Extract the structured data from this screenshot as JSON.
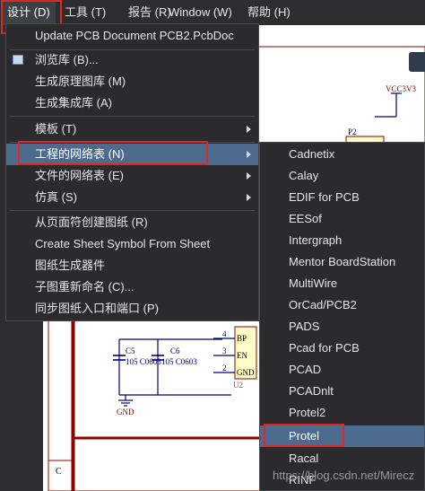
{
  "menubar": {
    "items": [
      {
        "label": "设计 (D)"
      },
      {
        "label": "工具 (T)"
      },
      {
        "label": "报告 (R)"
      },
      {
        "label": "Window (W)"
      },
      {
        "label": "帮助 (H)"
      }
    ]
  },
  "design_menu": {
    "items": [
      {
        "label": "Update PCB Document PCB2.PcbDoc"
      },
      {
        "label": "浏览库 (B)..."
      },
      {
        "label": "生成原理图库 (M)"
      },
      {
        "label": "生成集成库 (A)"
      },
      {
        "label": "模板 (T)"
      },
      {
        "label": "工程的网络表 (N)"
      },
      {
        "label": "文件的网络表 (E)"
      },
      {
        "label": "仿真 (S)"
      },
      {
        "label": "从页面符创建图纸 (R)"
      },
      {
        "label": "Create Sheet Symbol From Sheet"
      },
      {
        "label": "图纸生成器件"
      },
      {
        "label": "子图重新命名 (C)..."
      },
      {
        "label": "同步图纸入口和端口 (P)"
      }
    ]
  },
  "netlist_submenu": {
    "items": [
      {
        "label": "Cadnetix"
      },
      {
        "label": "Calay"
      },
      {
        "label": "EDIF for PCB"
      },
      {
        "label": "EESof"
      },
      {
        "label": "Intergraph"
      },
      {
        "label": "Mentor BoardStation"
      },
      {
        "label": "MultiWire"
      },
      {
        "label": "OrCad/PCB2"
      },
      {
        "label": "PADS"
      },
      {
        "label": "Pcad for PCB"
      },
      {
        "label": "PCAD"
      },
      {
        "label": "PCADnlt"
      },
      {
        "label": "Protel2"
      },
      {
        "label": "Protel"
      },
      {
        "label": "Racal"
      },
      {
        "label": "RINF"
      }
    ]
  },
  "schematic": {
    "vcc_label": "VCC3V3",
    "p2_label": "P2",
    "c5_label": "C5",
    "c6_label": "C6",
    "c5_value": "105 C0603",
    "c6_value": "105 C0603",
    "gnd_label": "GND",
    "pin_bp": "BP",
    "pin_en": "EN",
    "pin_gnd": "GND",
    "pin_numbers": [
      "4",
      "3",
      "2"
    ],
    "u_label": "U2",
    "border_letter": "C"
  },
  "watermark": "https://blog.csdn.net/Mirecz",
  "colors": {
    "menubar_bg": "#2d2d30",
    "menu_bg": "#2b2b2e",
    "selected_bg": "#4d6b8f",
    "highlight": "#e02525",
    "schematic_wire": "#000080",
    "schematic_border": "#8b0000"
  }
}
